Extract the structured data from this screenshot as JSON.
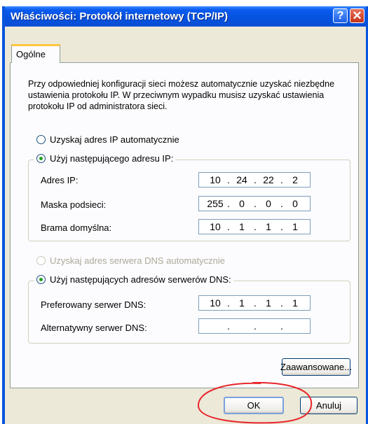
{
  "window": {
    "title": "Właściwości: Protokół internetowy (TCP/IP)",
    "help_glyph": "?",
    "close_glyph": "✕"
  },
  "tab": {
    "label": "Ogólne"
  },
  "description": "Przy odpowiedniej konfiguracji sieci możesz automatycznie uzyskać niezbędne ustawienia protokołu IP. W przeciwnym wypadku musisz uzyskać ustawienia protokołu IP od administratora sieci.",
  "ip_section": {
    "auto_label": "Uzyskaj adres IP automatycznie",
    "auto_selected": false,
    "manual_label": "Użyj następującego adresu IP:",
    "manual_selected": true,
    "fields": [
      {
        "label": "Adres IP:",
        "octets": [
          "10",
          "24",
          "22",
          "2"
        ]
      },
      {
        "label": "Maska podsieci:",
        "octets": [
          "255",
          "0",
          "0",
          "0"
        ]
      },
      {
        "label": "Brama domyślna:",
        "octets": [
          "10",
          "1",
          "1",
          "1"
        ]
      }
    ]
  },
  "dns_section": {
    "auto_label": "Uzyskaj adres serwera DNS automatycznie",
    "auto_enabled": false,
    "manual_label": "Użyj następujących adresów serwerów DNS:",
    "manual_selected": true,
    "fields": [
      {
        "label": "Preferowany serwer DNS:",
        "octets": [
          "10",
          "1",
          "1",
          "1"
        ]
      },
      {
        "label": "Alternatywny serwer DNS:",
        "octets": [
          "",
          "",
          "",
          ""
        ]
      }
    ]
  },
  "buttons": {
    "advanced": "Zaawansowane...",
    "ok": "OK",
    "cancel": "Anuluj"
  },
  "colors": {
    "titlebar": "#0552e0",
    "dialog_bg": "#ece9d8",
    "annotation": "#e8262a",
    "radio_dot": "#21a121"
  }
}
